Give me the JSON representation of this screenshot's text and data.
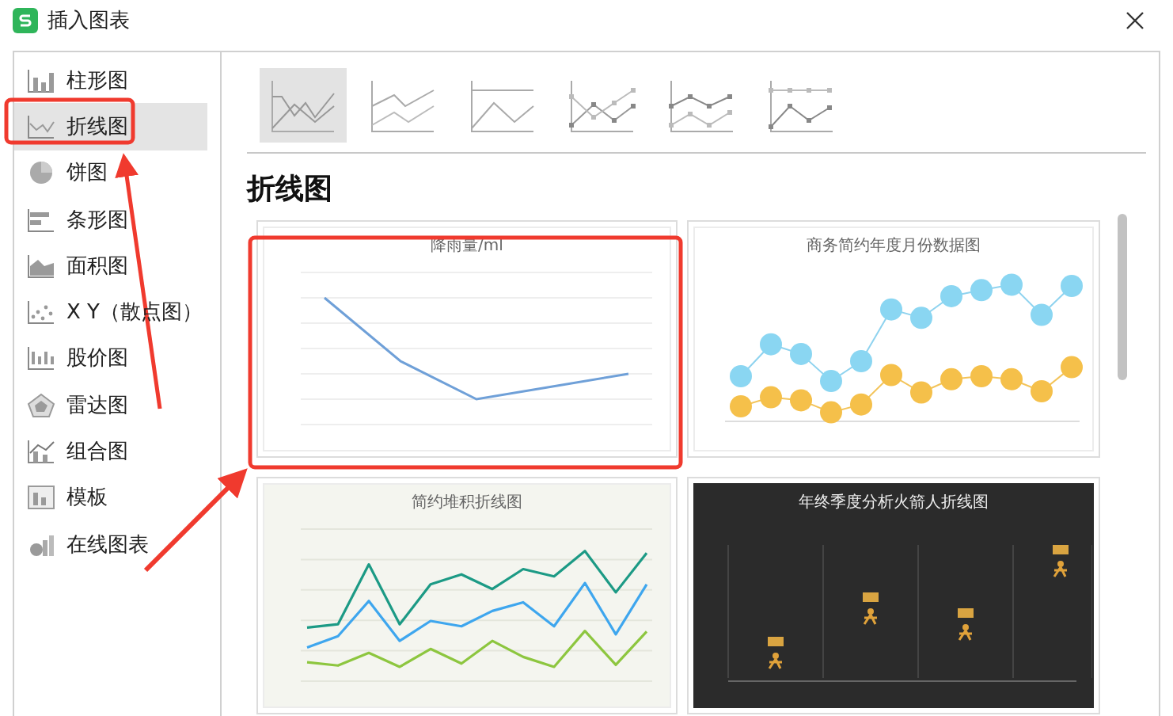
{
  "window": {
    "title": "插入图表"
  },
  "sidebar": {
    "items": [
      {
        "label": "柱形图",
        "kind": "column",
        "selected": false
      },
      {
        "label": "折线图",
        "kind": "line",
        "selected": true
      },
      {
        "label": "饼图",
        "kind": "pie",
        "selected": false
      },
      {
        "label": "条形图",
        "kind": "bar",
        "selected": false
      },
      {
        "label": "面积图",
        "kind": "area",
        "selected": false
      },
      {
        "label": "X Y（散点图）",
        "kind": "scatter",
        "selected": false
      },
      {
        "label": "股价图",
        "kind": "stock",
        "selected": false
      },
      {
        "label": "雷达图",
        "kind": "radar",
        "selected": false
      },
      {
        "label": "组合图",
        "kind": "combo",
        "selected": false
      },
      {
        "label": "模板",
        "kind": "template",
        "selected": false
      },
      {
        "label": "在线图表",
        "kind": "online",
        "selected": false
      }
    ]
  },
  "subtypes": [
    {
      "kind": "line",
      "selected": true
    },
    {
      "kind": "stacked",
      "selected": false
    },
    {
      "kind": "percent",
      "selected": false
    },
    {
      "kind": "line-markers",
      "selected": false
    },
    {
      "kind": "stacked-markers",
      "selected": false
    },
    {
      "kind": "percent-markers",
      "selected": false
    }
  ],
  "section_title": "折线图",
  "templates": [
    {
      "title": "降雨量/ml",
      "kind": "simple"
    },
    {
      "title": "商务简约年度月份数据图",
      "kind": "bubble"
    },
    {
      "title": "简约堆积折线图",
      "kind": "smooth"
    },
    {
      "title": "年终季度分析火箭人折线图",
      "kind": "runner"
    }
  ]
}
